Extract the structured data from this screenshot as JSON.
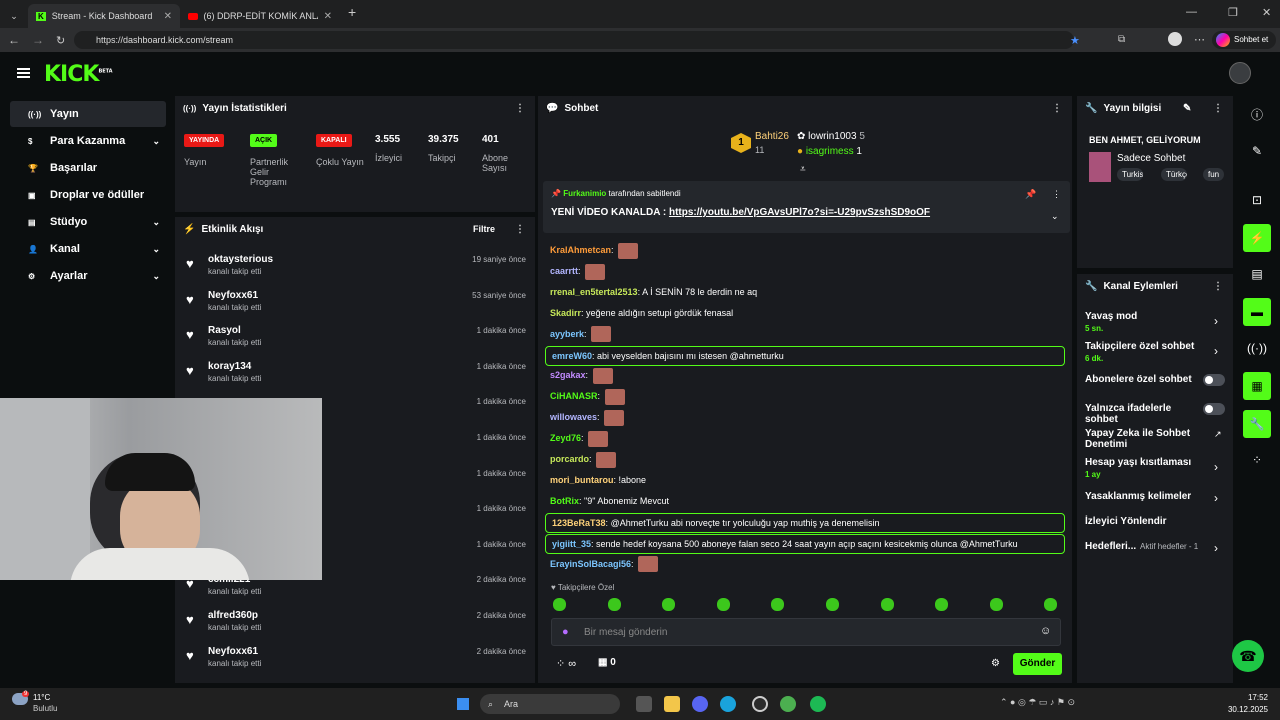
{
  "browser": {
    "tab1": "Stream - Kick Dashboard",
    "tab2": "(6) DDRP-EDİT KOMİK ANLAR 1 -",
    "url": "https://dashboard.kick.com/stream",
    "sync_label": "Sohbet et"
  },
  "brand": {
    "logo": "KICK",
    "beta": "BETA"
  },
  "nav": [
    {
      "label": "Yayın",
      "icon": "((·))"
    },
    {
      "label": "Para Kazanma",
      "icon": "$"
    },
    {
      "label": "Başarılar",
      "icon": "🏆"
    },
    {
      "label": "Droplar ve ödüller",
      "icon": "▣"
    },
    {
      "label": "Stüdyo",
      "icon": "▤"
    },
    {
      "label": "Kanal",
      "icon": "👤"
    },
    {
      "label": "Ayarlar",
      "icon": "⚙"
    }
  ],
  "stats": {
    "title": "Yayın İstatistikleri",
    "badges": [
      {
        "badge": "YAYINDA",
        "label": "Yayın"
      },
      {
        "badge": "AÇIK",
        "label": "Partnerlik Gelir Programı"
      },
      {
        "badge": "KAPALI",
        "label": "Çoklu Yayın"
      }
    ],
    "numbers": [
      {
        "value": "3.555",
        "label": "İzleyici"
      },
      {
        "value": "39.375",
        "label": "Takipçi"
      },
      {
        "value": "401",
        "label": "Abone Sayısı"
      }
    ]
  },
  "activity": {
    "title": "Etkinlik Akışı",
    "filter": "Filtre",
    "follow_text": "kanalı takip etti",
    "items": [
      {
        "user": "oktaysterious",
        "time": "19 saniye önce"
      },
      {
        "user": "Neyfoxx61",
        "time": "53 saniye önce"
      },
      {
        "user": "Rasyol",
        "time": "1 dakika önce"
      },
      {
        "user": "koray134",
        "time": "1 dakika önce"
      },
      {
        "user": "",
        "time": "1 dakika önce"
      },
      {
        "user": "",
        "time": "1 dakika önce"
      },
      {
        "user": "",
        "time": "1 dakika önce"
      },
      {
        "user": "",
        "time": "1 dakika önce"
      },
      {
        "user": "",
        "time": "1 dakika önce"
      },
      {
        "user": "ccmil221",
        "time": "2 dakika önce"
      },
      {
        "user": "alfred360p",
        "time": "2 dakika önce"
      },
      {
        "user": "Neyfoxx61",
        "time": "2 dakika önce"
      }
    ]
  },
  "chat": {
    "title": "Sohbet",
    "leaders": [
      {
        "rank": "1",
        "name": "Bahti26",
        "count": "11"
      },
      {
        "name": "lowrin1003",
        "count": "5"
      },
      {
        "name": "isagrimess",
        "count": "1"
      }
    ],
    "pinned": {
      "by_user": "Furkanimio",
      "by_suffix": "tarafından sabitlendi",
      "text": "YENİ VİDEO KANALDA :",
      "link": "https://youtu.be/VpGAvsUPl7o?si=-U29pvSzshSD9oOF"
    },
    "messages": [
      {
        "user": "KralAhmetcan",
        "color": "#ff9c3a",
        "text": "",
        "emote": true
      },
      {
        "user": "caarrtt",
        "color": "#b3b6ff",
        "text": "",
        "emote": true
      },
      {
        "user": "rrenal_en5tertal2513",
        "color": "#c6e85a",
        "text": "A İ SENİN 78 le derdin ne aq"
      },
      {
        "user": "Skadirr",
        "color": "#c6e85a",
        "text": "yeğene aldığın setupi gördük fenasal"
      },
      {
        "user": "ayyberk",
        "color": "#7cc6ff",
        "text": "",
        "emote": true
      },
      {
        "user": "emreW60",
        "color": "#7cc6ff",
        "text": "abi veyselden bajısını mı istesen @ahmetturku",
        "hl": true
      },
      {
        "user": "s2gakax",
        "color": "#c18bff",
        "text": "",
        "emote": true
      },
      {
        "user": "CiHANASR",
        "color": "#53fc18",
        "text": "",
        "emote": true
      },
      {
        "user": "willowaves",
        "color": "#b3b6ff",
        "text": "",
        "emote": true
      },
      {
        "user": "Zeyd76",
        "color": "#53fc18",
        "text": "",
        "emote": true
      },
      {
        "user": "porcardo",
        "color": "#c6e85a",
        "text": "",
        "emote": true
      },
      {
        "user": "mori_buntarou",
        "color": "#ffd27a",
        "text": "!abone"
      },
      {
        "user": "BotRix",
        "color": "#53fc18",
        "text": "\"9\" Abonemiz Mevcut"
      },
      {
        "user": "123BeRaT38",
        "color": "#ffd27a",
        "text": "@AhmetTurku abi norveçte tır yolculuğu yap muthiş ya denemelisin",
        "hl": true
      },
      {
        "user": "yigiitt_35",
        "color": "#7cc6ff",
        "text": "sende hedef koysana 500 aboneye falan seco 24 saat yayın açıp saçını kesicekmiş olunca @AhmetTurku",
        "hl": true
      },
      {
        "user": "ErayinSolBacagi56",
        "color": "#7cc6ff",
        "text": "",
        "emote": true
      }
    ],
    "followers_only": "Takipçilere Özel",
    "input_placeholder": "Bir mesaj gönderin",
    "points": "∞",
    "gifts": "0",
    "send": "Gönder"
  },
  "info": {
    "title": "Yayın bilgisi",
    "stream_title": "BEN AHMET, GELİYORUM",
    "category": "Sadece Sohbet",
    "tags": [
      "Turkish",
      "Türkçe",
      "fun"
    ]
  },
  "actions": {
    "title": "Kanal Eylemleri",
    "items": [
      {
        "label": "Yavaş mod",
        "sub": "5 sn.",
        "ctl": "chev"
      },
      {
        "label": "Takipçilere özel sohbet",
        "sub": "6 dk.",
        "ctl": "chev"
      },
      {
        "label": "Abonelere özel sohbet",
        "sub": "",
        "ctl": "toggle"
      },
      {
        "label": "Yalnızca ifadelerle sohbet",
        "sub": "",
        "ctl": "toggle"
      },
      {
        "label": "Yapay Zeka ile Sohbet Denetimi",
        "sub": "",
        "ctl": "ext"
      },
      {
        "label": "Hesap yaşı kısıtlaması",
        "sub": "1 ay",
        "ctl": "chev"
      },
      {
        "label": "Yasaklanmış kelimeler",
        "sub": "",
        "ctl": "chev"
      },
      {
        "label": "İzleyici Yönlendir",
        "sub": "",
        "ctl": ""
      },
      {
        "label": "Hedefleri...",
        "sub": "",
        "ctl": "chev",
        "extra": "Aktif hedefler - 1"
      }
    ]
  },
  "taskbar": {
    "weather_temp": "11°C",
    "weather_desc": "Bulutlu",
    "search": "Ara",
    "time": "17:52",
    "date": "30.12.2025",
    "badge": "9"
  },
  "colors": {
    "brand": "#53fc18",
    "bg": "#0b0e0f",
    "panel": "#191b1f"
  }
}
